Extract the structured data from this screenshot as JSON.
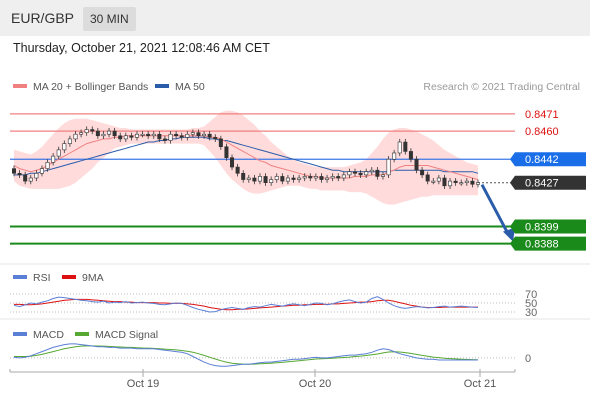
{
  "header": {
    "symbol": "EUR/GBP",
    "timeframe": "30 MIN"
  },
  "timestamp": "Thursday, October 21, 2021 12:08:46 AM CET",
  "colors": {
    "ma20": "#f08080",
    "ma50": "#2a5caa",
    "bollinger_fill": "#ffd5d5",
    "candle": "#333333",
    "resistance": "#f08080",
    "support": "#1a8a1a",
    "current": "#333333",
    "arrow": "#2a5caa",
    "rsi": "#5b7fd6",
    "rsi_ma": "#dd1111",
    "macd": "#5b7fd6",
    "macd_signal": "#56a832"
  },
  "chart_data": [
    {
      "type": "line",
      "name": "price",
      "legend": [
        "MA 20 + Bollinger Bands",
        "MA 50"
      ],
      "watermark": "Research © 2021 Trading Central",
      "x_ticks": [
        "Oct 19",
        "Oct 20",
        "Oct 21"
      ],
      "ylim": [
        0.8375,
        0.8485
      ],
      "levels": [
        {
          "label": "0.8471",
          "value": 0.8471,
          "kind": "resistance"
        },
        {
          "label": "0.8460",
          "value": 0.846,
          "kind": "resistance"
        },
        {
          "label": "0.8442",
          "value": 0.8442,
          "kind": "pivot"
        },
        {
          "label": "0.8427",
          "value": 0.8427,
          "kind": "current"
        },
        {
          "label": "0.8399",
          "value": 0.8399,
          "kind": "support"
        },
        {
          "label": "0.8388",
          "value": 0.8388,
          "kind": "support"
        }
      ],
      "close": [
        0.8433,
        0.8432,
        0.8428,
        0.843,
        0.8433,
        0.8436,
        0.844,
        0.8444,
        0.8448,
        0.8452,
        0.8455,
        0.8458,
        0.8459,
        0.8461,
        0.846,
        0.8457,
        0.8458,
        0.846,
        0.8457,
        0.8455,
        0.8457,
        0.8456,
        0.8458,
        0.8458,
        0.8457,
        0.8458,
        0.8455,
        0.8454,
        0.8458,
        0.8457,
        0.8456,
        0.8458,
        0.8459,
        0.8457,
        0.8458,
        0.8456,
        0.8455,
        0.845,
        0.8443,
        0.8437,
        0.8433,
        0.8429,
        0.843,
        0.8428,
        0.8431,
        0.8427,
        0.8429,
        0.8431,
        0.8428,
        0.843,
        0.8429,
        0.843,
        0.8431,
        0.843,
        0.8431,
        0.8429,
        0.843,
        0.8431,
        0.843,
        0.8432,
        0.8434,
        0.8433,
        0.8432,
        0.8434,
        0.8435,
        0.8431,
        0.8432,
        0.8442,
        0.8446,
        0.8453,
        0.8447,
        0.8442,
        0.8435,
        0.8432,
        0.8428,
        0.8428,
        0.843,
        0.8425,
        0.8428,
        0.8427,
        0.8427,
        0.8428,
        0.8426,
        0.8427
      ],
      "ma20": [
        0.8438,
        0.8436,
        0.8435,
        0.8434,
        0.8435,
        0.8436,
        0.8438,
        0.844,
        0.8442,
        0.8444,
        0.8446,
        0.8448,
        0.845,
        0.8452,
        0.8453,
        0.8454,
        0.8455,
        0.8455,
        0.8456,
        0.8456,
        0.8457,
        0.8457,
        0.8457,
        0.8457,
        0.8457,
        0.8457,
        0.8457,
        0.8457,
        0.8457,
        0.8457,
        0.8457,
        0.8457,
        0.8457,
        0.8457,
        0.8457,
        0.8456,
        0.8456,
        0.8455,
        0.8453,
        0.8451,
        0.8449,
        0.8447,
        0.8445,
        0.8443,
        0.8441,
        0.844,
        0.8438,
        0.8437,
        0.8436,
        0.8435,
        0.8434,
        0.8433,
        0.8432,
        0.8431,
        0.8431,
        0.843,
        0.843,
        0.843,
        0.843,
        0.843,
        0.843,
        0.8431,
        0.8431,
        0.8431,
        0.8432,
        0.8432,
        0.8432,
        0.8434,
        0.8435,
        0.8437,
        0.8438,
        0.8438,
        0.8438,
        0.8438,
        0.8438,
        0.8437,
        0.8436,
        0.8435,
        0.8434,
        0.8433,
        0.8432,
        0.8431,
        0.843,
        0.8429
      ],
      "bollinger_upper": [
        0.8448,
        0.8447,
        0.8446,
        0.8445,
        0.8447,
        0.845,
        0.8454,
        0.8458,
        0.8462,
        0.8465,
        0.8467,
        0.8468,
        0.8468,
        0.8468,
        0.8467,
        0.8466,
        0.8465,
        0.8464,
        0.8463,
        0.8462,
        0.8462,
        0.8461,
        0.8461,
        0.8461,
        0.8461,
        0.8461,
        0.8461,
        0.8461,
        0.8461,
        0.8461,
        0.8461,
        0.8461,
        0.8462,
        0.8462,
        0.8463,
        0.8466,
        0.8469,
        0.8472,
        0.8473,
        0.8473,
        0.8472,
        0.847,
        0.8467,
        0.8464,
        0.846,
        0.8457,
        0.8453,
        0.845,
        0.8447,
        0.8444,
        0.8442,
        0.844,
        0.8439,
        0.8438,
        0.8437,
        0.8437,
        0.8437,
        0.8437,
        0.8437,
        0.8437,
        0.8438,
        0.8439,
        0.844,
        0.8442,
        0.8446,
        0.845,
        0.8455,
        0.8459,
        0.8461,
        0.8462,
        0.8462,
        0.8461,
        0.846,
        0.8458,
        0.8456,
        0.8454,
        0.8451,
        0.8448,
        0.8446,
        0.8444,
        0.8442,
        0.844,
        0.8439,
        0.8438
      ],
      "bollinger_lower": [
        0.8428,
        0.8425,
        0.8424,
        0.8423,
        0.8423,
        0.8423,
        0.8423,
        0.8423,
        0.8423,
        0.8424,
        0.8425,
        0.8427,
        0.843,
        0.8433,
        0.8436,
        0.844,
        0.8443,
        0.8446,
        0.8449,
        0.845,
        0.8451,
        0.8452,
        0.8452,
        0.8452,
        0.8452,
        0.8452,
        0.8452,
        0.8452,
        0.8452,
        0.8452,
        0.8452,
        0.8452,
        0.8452,
        0.8452,
        0.8451,
        0.8447,
        0.8443,
        0.8438,
        0.8433,
        0.8429,
        0.8426,
        0.8423,
        0.8421,
        0.842,
        0.842,
        0.8421,
        0.8422,
        0.8423,
        0.8424,
        0.8425,
        0.8425,
        0.8425,
        0.8424,
        0.8423,
        0.8423,
        0.8422,
        0.8422,
        0.8422,
        0.8422,
        0.8422,
        0.8421,
        0.8421,
        0.8421,
        0.842,
        0.8418,
        0.8416,
        0.8414,
        0.8413,
        0.8413,
        0.8414,
        0.8415,
        0.8416,
        0.8417,
        0.8418,
        0.8418,
        0.8419,
        0.8419,
        0.8419,
        0.8419,
        0.8419,
        0.8419,
        0.8419,
        0.8419,
        0.8419
      ],
      "ma50": [
        0.8432,
        0.8432,
        0.8432,
        0.8433,
        0.8433,
        0.8434,
        0.8435,
        0.8436,
        0.8437,
        0.8438,
        0.8439,
        0.844,
        0.8441,
        0.8442,
        0.8443,
        0.8444,
        0.8445,
        0.8446,
        0.8447,
        0.8448,
        0.8449,
        0.845,
        0.8451,
        0.8452,
        0.8453,
        0.8453,
        0.8454,
        0.8454,
        0.8455,
        0.8455,
        0.8456,
        0.8456,
        0.8456,
        0.8456,
        0.8456,
        0.8455,
        0.8455,
        0.8454,
        0.8454,
        0.8453,
        0.8452,
        0.8451,
        0.845,
        0.8449,
        0.8448,
        0.8447,
        0.8446,
        0.8445,
        0.8444,
        0.8443,
        0.8442,
        0.8441,
        0.844,
        0.8439,
        0.8438,
        0.8437,
        0.8436,
        0.8435,
        0.8435,
        0.8434,
        0.8434,
        0.8434,
        0.8434,
        0.8434,
        0.8434,
        0.8434,
        0.8434,
        0.8434,
        0.8435,
        0.8435,
        0.8435,
        0.8435,
        0.8435,
        0.8435,
        0.8435,
        0.8435,
        0.8435,
        0.8434,
        0.8434,
        0.8434,
        0.8434,
        0.8434,
        0.8434,
        0.8433
      ]
    },
    {
      "type": "line",
      "name": "rsi",
      "legend": [
        "RSI",
        "9MA"
      ],
      "y_ticks": [
        "70",
        "50",
        "30"
      ],
      "ylim": [
        20,
        80
      ],
      "rsi": [
        45,
        42,
        46,
        50,
        48,
        52,
        55,
        60,
        63,
        62,
        60,
        58,
        56,
        55,
        53,
        52,
        54,
        50,
        52,
        51,
        53,
        50,
        51,
        52,
        50,
        49,
        47,
        46,
        48,
        50,
        49,
        45,
        40,
        36,
        33,
        30,
        31,
        35,
        38,
        40,
        38,
        36,
        40,
        42,
        41,
        44,
        47,
        45,
        43,
        46,
        48,
        46,
        44,
        47,
        50,
        49,
        46,
        48,
        52,
        55,
        57,
        53,
        50,
        52,
        60,
        64,
        58,
        50,
        44,
        40,
        38,
        40,
        42,
        41,
        39,
        40,
        42,
        43,
        41,
        42,
        43,
        42,
        41,
        40
      ],
      "ma9": [
        47,
        47,
        46,
        46,
        47,
        48,
        50,
        52,
        54,
        56,
        57,
        58,
        58,
        58,
        57,
        56,
        55,
        54,
        53,
        53,
        52,
        52,
        51,
        51,
        51,
        51,
        50,
        50,
        49,
        49,
        49,
        48,
        47,
        45,
        43,
        40,
        38,
        36,
        35,
        35,
        36,
        36,
        37,
        38,
        39,
        40,
        41,
        42,
        43,
        44,
        45,
        45,
        46,
        46,
        47,
        47,
        47,
        48,
        48,
        49,
        50,
        51,
        52,
        52,
        53,
        55,
        56,
        56,
        54,
        51,
        48,
        45,
        43,
        41,
        40,
        40,
        40,
        41,
        41,
        41,
        41,
        41,
        41,
        41
      ]
    },
    {
      "type": "line",
      "name": "macd",
      "legend": [
        "MACD",
        "MACD Signal"
      ],
      "y_ticks": [
        "0"
      ],
      "macd": [
        0.05,
        0.0,
        0.05,
        0.15,
        0.3,
        0.45,
        0.6,
        0.75,
        0.85,
        0.95,
        1.0,
        1.0,
        0.95,
        0.9,
        0.85,
        0.8,
        0.8,
        0.75,
        0.75,
        0.7,
        0.7,
        0.7,
        0.65,
        0.65,
        0.65,
        0.65,
        0.6,
        0.55,
        0.5,
        0.45,
        0.4,
        0.3,
        0.1,
        -0.1,
        -0.3,
        -0.45,
        -0.55,
        -0.6,
        -0.6,
        -0.55,
        -0.5,
        -0.45,
        -0.45,
        -0.4,
        -0.35,
        -0.3,
        -0.3,
        -0.25,
        -0.2,
        -0.15,
        -0.1,
        -0.1,
        -0.05,
        0.0,
        0.05,
        0.0,
        0.0,
        0.05,
        0.1,
        0.15,
        0.2,
        0.2,
        0.25,
        0.3,
        0.4,
        0.55,
        0.65,
        0.6,
        0.45,
        0.3,
        0.2,
        0.1,
        0.0,
        -0.05,
        -0.1,
        -0.1,
        -0.15,
        -0.15,
        -0.15,
        -0.15,
        -0.15,
        -0.15,
        -0.15,
        -0.15
      ],
      "signal": [
        0.1,
        0.1,
        0.1,
        0.12,
        0.18,
        0.25,
        0.35,
        0.45,
        0.55,
        0.65,
        0.73,
        0.8,
        0.84,
        0.86,
        0.86,
        0.85,
        0.84,
        0.82,
        0.8,
        0.78,
        0.76,
        0.75,
        0.73,
        0.71,
        0.7,
        0.68,
        0.66,
        0.63,
        0.6,
        0.57,
        0.53,
        0.48,
        0.4,
        0.3,
        0.18,
        0.05,
        -0.08,
        -0.2,
        -0.3,
        -0.38,
        -0.42,
        -0.44,
        -0.45,
        -0.44,
        -0.42,
        -0.4,
        -0.38,
        -0.35,
        -0.32,
        -0.28,
        -0.24,
        -0.2,
        -0.16,
        -0.12,
        -0.08,
        -0.06,
        -0.04,
        -0.02,
        0.0,
        0.03,
        0.06,
        0.1,
        0.13,
        0.17,
        0.22,
        0.28,
        0.36,
        0.42,
        0.44,
        0.42,
        0.38,
        0.32,
        0.25,
        0.18,
        0.12,
        0.06,
        0.02,
        -0.02,
        -0.05,
        -0.07,
        -0.09,
        -0.11,
        -0.12,
        -0.13
      ]
    }
  ]
}
